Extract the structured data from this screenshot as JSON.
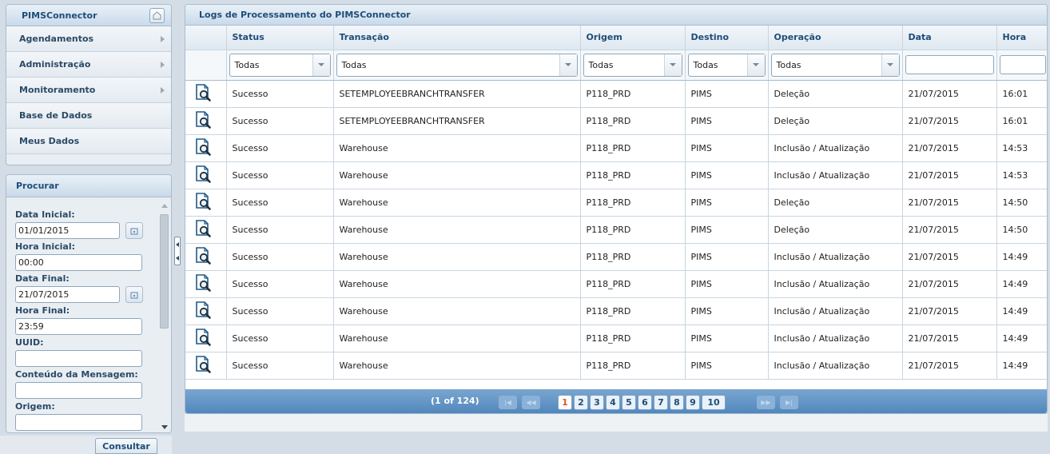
{
  "nav": {
    "title": "PIMSConnector",
    "items": [
      {
        "label": "Agendamentos",
        "has_arrow": true
      },
      {
        "label": "Administração",
        "has_arrow": true
      },
      {
        "label": "Monitoramento",
        "has_arrow": true
      },
      {
        "label": "Base de Dados",
        "has_arrow": false
      },
      {
        "label": "Meus Dados",
        "has_arrow": false
      }
    ]
  },
  "search": {
    "title": "Procurar",
    "data_inicial_label": "Data Inicial:",
    "data_inicial_value": "01/01/2015",
    "hora_inicial_label": "Hora Inicial:",
    "hora_inicial_value": "00:00",
    "data_final_label": "Data Final:",
    "data_final_value": "21/07/2015",
    "hora_final_label": "Hora Final:",
    "hora_final_value": "23:59",
    "uuid_label": "UUID:",
    "uuid_value": "",
    "conteudo_label": "Conteúdo da Mensagem:",
    "conteudo_value": "",
    "origem_label": "Origem:",
    "consultar_label": "Consultar"
  },
  "main": {
    "title": "Logs de Processamento do PIMSConnector",
    "columns": [
      "Status",
      "Transação",
      "Origem",
      "Destino",
      "Operação",
      "Data",
      "Hora"
    ],
    "filters": {
      "status": "Todas",
      "transacao": "Todas",
      "origem": "Todas",
      "destino": "Todas",
      "operacao": "Todas",
      "data": "",
      "hora": ""
    },
    "rows": [
      [
        "Sucesso",
        "SETEMPLOYEEBRANCHTRANSFER",
        "P118_PRD",
        "PIMS",
        "Deleção",
        "21/07/2015",
        "16:01"
      ],
      [
        "Sucesso",
        "SETEMPLOYEEBRANCHTRANSFER",
        "P118_PRD",
        "PIMS",
        "Deleção",
        "21/07/2015",
        "16:01"
      ],
      [
        "Sucesso",
        "Warehouse",
        "P118_PRD",
        "PIMS",
        "Inclusão / Atualização",
        "21/07/2015",
        "14:53"
      ],
      [
        "Sucesso",
        "Warehouse",
        "P118_PRD",
        "PIMS",
        "Inclusão / Atualização",
        "21/07/2015",
        "14:53"
      ],
      [
        "Sucesso",
        "Warehouse",
        "P118_PRD",
        "PIMS",
        "Deleção",
        "21/07/2015",
        "14:50"
      ],
      [
        "Sucesso",
        "Warehouse",
        "P118_PRD",
        "PIMS",
        "Deleção",
        "21/07/2015",
        "14:50"
      ],
      [
        "Sucesso",
        "Warehouse",
        "P118_PRD",
        "PIMS",
        "Inclusão / Atualização",
        "21/07/2015",
        "14:49"
      ],
      [
        "Sucesso",
        "Warehouse",
        "P118_PRD",
        "PIMS",
        "Inclusão / Atualização",
        "21/07/2015",
        "14:49"
      ],
      [
        "Sucesso",
        "Warehouse",
        "P118_PRD",
        "PIMS",
        "Inclusão / Atualização",
        "21/07/2015",
        "14:49"
      ],
      [
        "Sucesso",
        "Warehouse",
        "P118_PRD",
        "PIMS",
        "Inclusão / Atualização",
        "21/07/2015",
        "14:49"
      ],
      [
        "Sucesso",
        "Warehouse",
        "P118_PRD",
        "PIMS",
        "Inclusão / Atualização",
        "21/07/2015",
        "14:49"
      ]
    ],
    "row_icon": "magnifier-document-icon"
  },
  "pager": {
    "count": "(1 of 124)",
    "pages": [
      "1",
      "2",
      "3",
      "4",
      "5",
      "6",
      "7",
      "8",
      "9",
      "10"
    ],
    "current_page": "1"
  },
  "colors": {
    "header_text": "#1e4d78",
    "pager_bg": "#4f85bb",
    "active_page": "#e0561a"
  }
}
